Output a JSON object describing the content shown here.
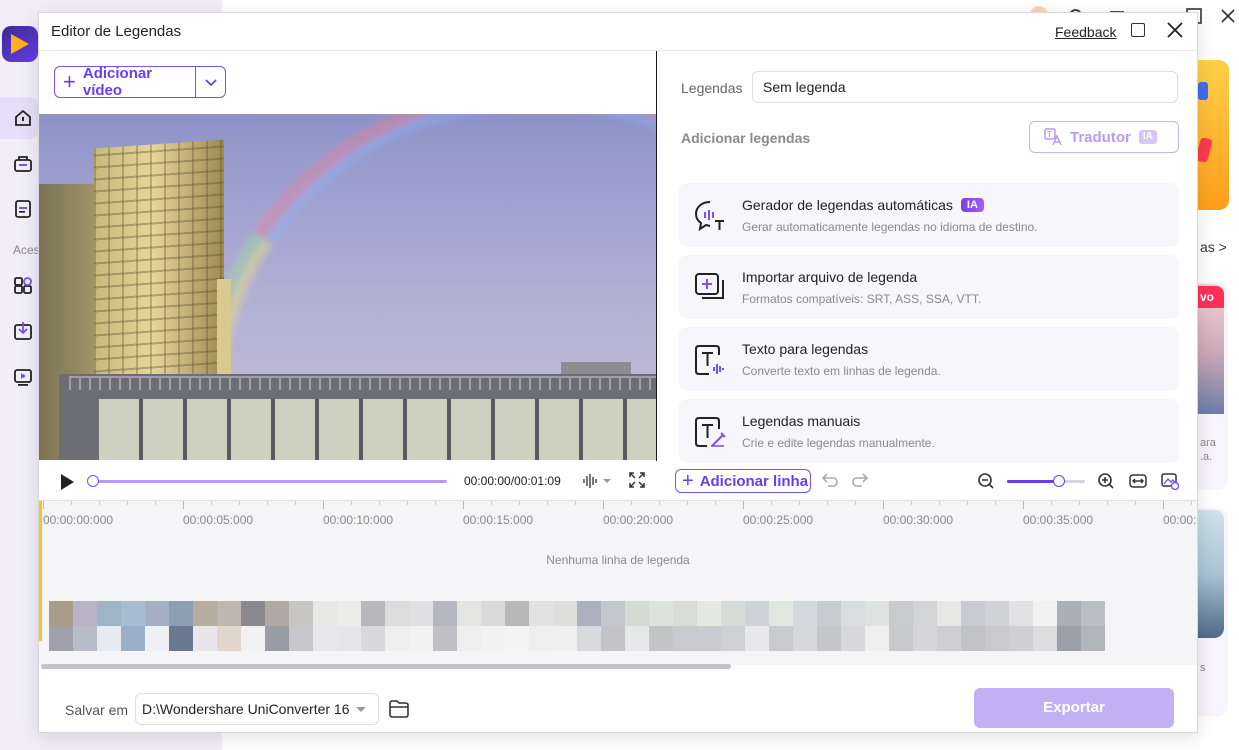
{
  "background": {
    "sidebar_label": "Aces",
    "card_link": "as >",
    "card_tag": "vo",
    "card2_text": "ara\n.a.",
    "card3_text": "s"
  },
  "dialog": {
    "title": "Editor de Legendas",
    "feedback": "Feedback"
  },
  "left": {
    "add_video": "Adicionar vídeo",
    "time": "00:00:00/00:01:09"
  },
  "right": {
    "subtitles_label": "Legendas",
    "subtitles_value": "Sem legenda",
    "add_subtitles": "Adicionar legendas",
    "translator": "Tradutor",
    "translator_badge": "IA",
    "options": [
      {
        "title": "Gerador de legendas automáticas",
        "badge": "IA",
        "subtitle": "Gerar automaticamente legendas no idioma de destino."
      },
      {
        "title": "Importar arquivo de legenda",
        "subtitle": "Formatos compatíveis: SRT, ASS, SSA, VTT."
      },
      {
        "title": "Texto para legendas",
        "subtitle": "Converte texto em linhas de legenda."
      },
      {
        "title": "Legendas manuais",
        "subtitle": "Crie e edite legendas manualmente."
      }
    ],
    "add_line": "Adicionar linha",
    "zoom_level": 0.67
  },
  "timeline": {
    "ticks": [
      "00:00:00:000",
      "00:00:05:000",
      "00:00:10:000",
      "00:00:15:000",
      "00:00:20:000",
      "00:00:25:000",
      "00:00:30:000",
      "00:00:35:000",
      "00:00:0"
    ],
    "empty_message": "Nenhuma linha de legenda"
  },
  "footer": {
    "save_label": "Salvar em",
    "save_path": "D:\\Wondershare UniConverter 16",
    "export": "Exportar"
  },
  "colors": {
    "accent": "#6a3df0",
    "export_disabled": "#c2b0f5",
    "playhead": "#ffc21a"
  }
}
